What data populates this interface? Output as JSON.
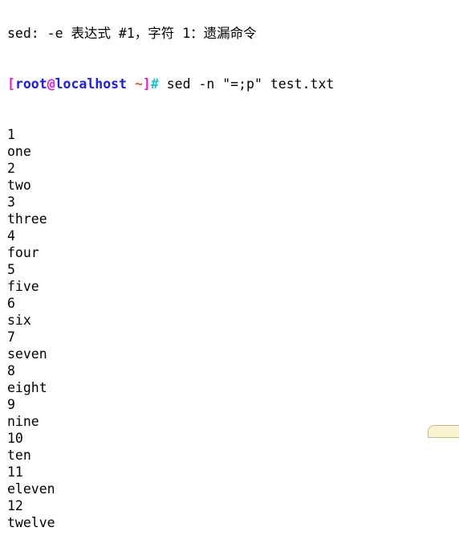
{
  "terminal": {
    "error_line": "sed: -e 表达式 #1，字符 1：遗漏命令",
    "prompt": {
      "open": "[",
      "user": "root",
      "at": "@",
      "host": "localhost",
      "space": " ",
      "dir": "~",
      "close": "]",
      "hash": "#"
    },
    "command": " sed -n \"=;p\" test.txt",
    "output": [
      "1",
      "one",
      "2",
      "two",
      "3",
      "three",
      "4",
      "four",
      "5",
      "five",
      "6",
      "six",
      "7",
      "seven",
      "8",
      "eight",
      "9",
      "nine",
      "10",
      "ten",
      "11",
      "eleven",
      "12",
      "twelve"
    ]
  }
}
